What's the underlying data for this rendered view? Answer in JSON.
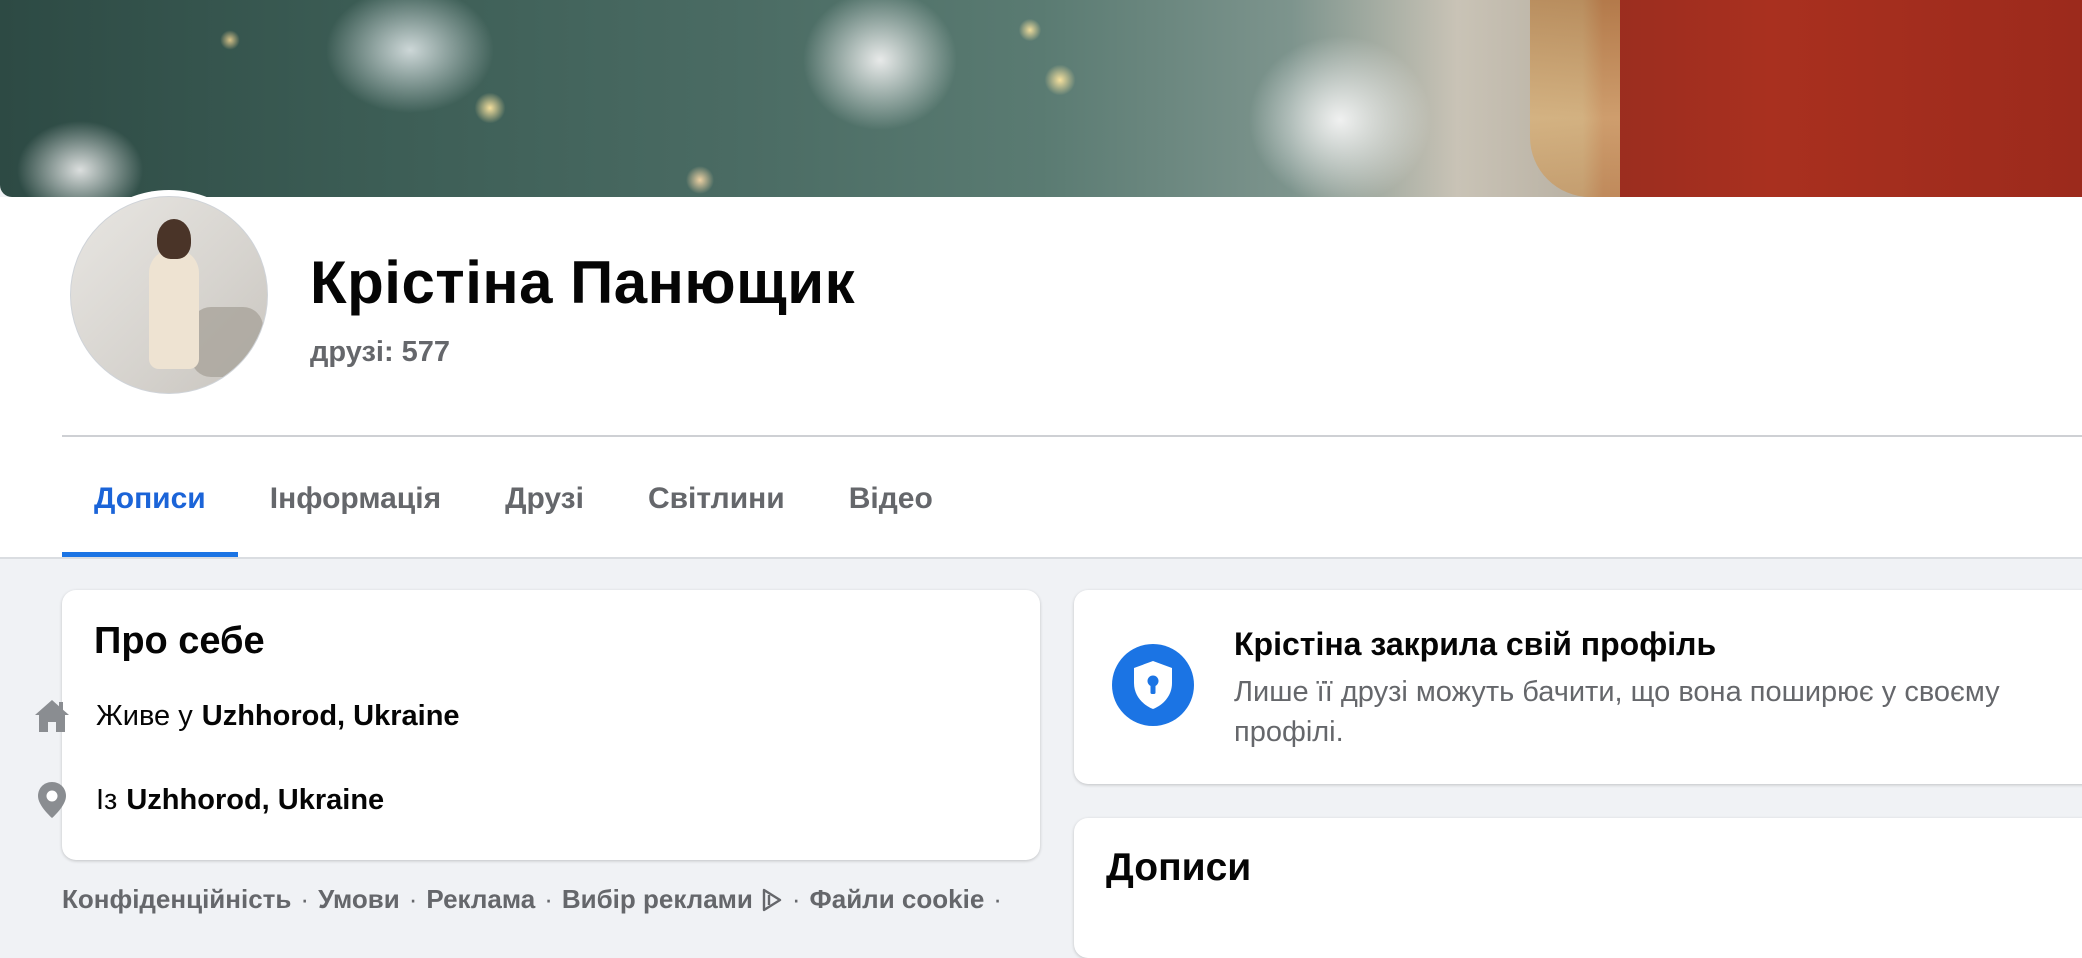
{
  "profile": {
    "name": "Крістіна Панющик",
    "friends": "друзі: 577"
  },
  "tabs": [
    {
      "label": "Дописи",
      "active": true
    },
    {
      "label": "Інформація",
      "active": false
    },
    {
      "label": "Друзі",
      "active": false
    },
    {
      "label": "Світлини",
      "active": false
    },
    {
      "label": "Відео",
      "active": false
    }
  ],
  "about": {
    "title": "Про себе",
    "lives_prefix": "Живе у",
    "lives_place": "Uzhhorod, Ukraine",
    "from_prefix": "Із",
    "from_place": "Uzhhorod, Ukraine",
    "icons": [
      "home-icon",
      "location-pin-icon"
    ]
  },
  "privacy": {
    "title": "Крістіна закрила свій профіль",
    "description": "Лише її друзі можуть бачити, що вона поширює у своєму профілі.",
    "icon": "shield-lock-icon"
  },
  "posts": {
    "title": "Дописи"
  },
  "footer": {
    "links": [
      "Конфіденційність",
      "Умови",
      "Реклама",
      "Вибір реклами",
      "Файли cookie"
    ],
    "separator": "·"
  },
  "colors": {
    "accent": "#1b74e4",
    "active_tab_text": "#1b64d8",
    "secondary_text": "#65676b",
    "page_background": "#f0f2f5"
  }
}
